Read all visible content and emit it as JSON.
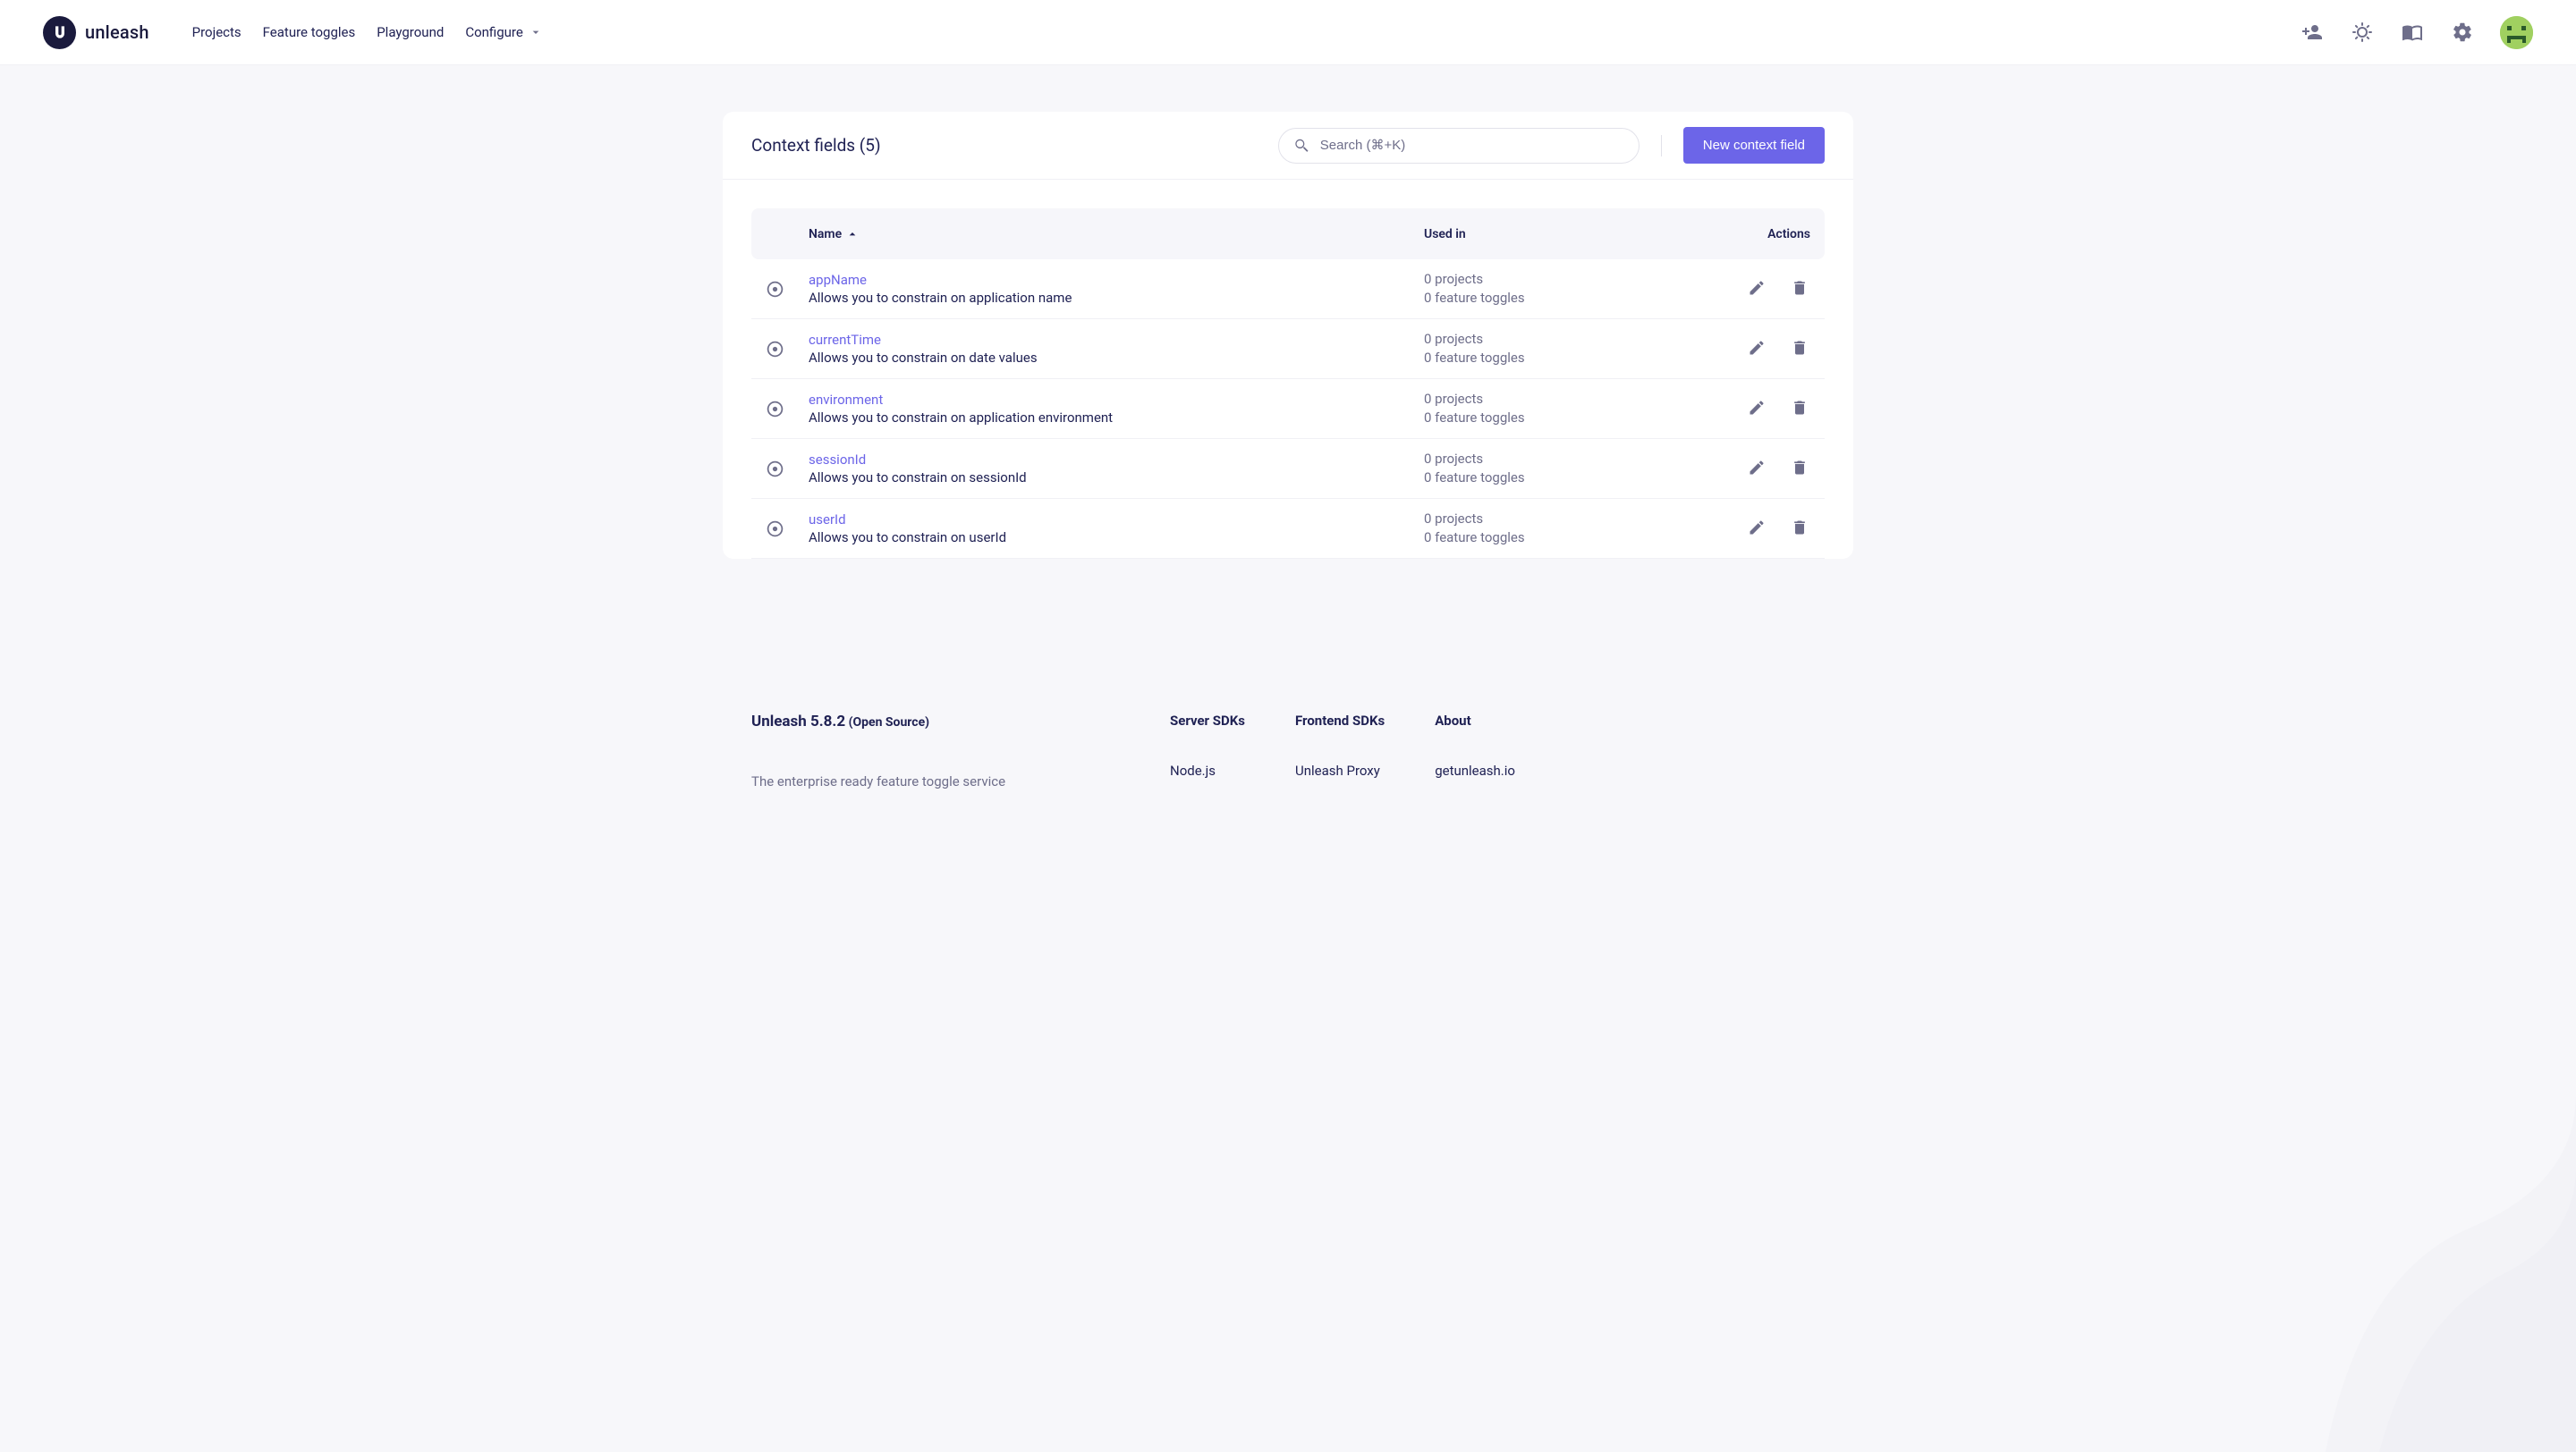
{
  "brand": {
    "name": "unleash"
  },
  "nav": {
    "projects": "Projects",
    "toggles": "Feature toggles",
    "playground": "Playground",
    "configure": "Configure"
  },
  "page": {
    "title": "Context fields (5)",
    "search_placeholder": "Search (⌘+K)",
    "new_btn": "New context field"
  },
  "columns": {
    "name": "Name",
    "used_in": "Used in",
    "actions": "Actions"
  },
  "rows": [
    {
      "name": "appName",
      "desc": "Allows you to constrain on application name",
      "projects": "0 projects",
      "toggles": "0 feature toggles"
    },
    {
      "name": "currentTime",
      "desc": "Allows you to constrain on date values",
      "projects": "0 projects",
      "toggles": "0 feature toggles"
    },
    {
      "name": "environment",
      "desc": "Allows you to constrain on application environment",
      "projects": "0 projects",
      "toggles": "0 feature toggles"
    },
    {
      "name": "sessionId",
      "desc": "Allows you to constrain on sessionId",
      "projects": "0 projects",
      "toggles": "0 feature toggles"
    },
    {
      "name": "userId",
      "desc": "Allows you to constrain on userId",
      "projects": "0 projects",
      "toggles": "0 feature toggles"
    }
  ],
  "footer": {
    "product": "Unleash 5.8.2",
    "edition": "(Open Source)",
    "tagline": "The enterprise ready feature toggle service",
    "cols": {
      "server_sdks": {
        "title": "Server SDKs",
        "links": [
          "Node.js"
        ]
      },
      "frontend_sdks": {
        "title": "Frontend SDKs",
        "links": [
          "Unleash Proxy"
        ]
      },
      "about": {
        "title": "About",
        "links": [
          "getunleash.io"
        ]
      }
    }
  }
}
